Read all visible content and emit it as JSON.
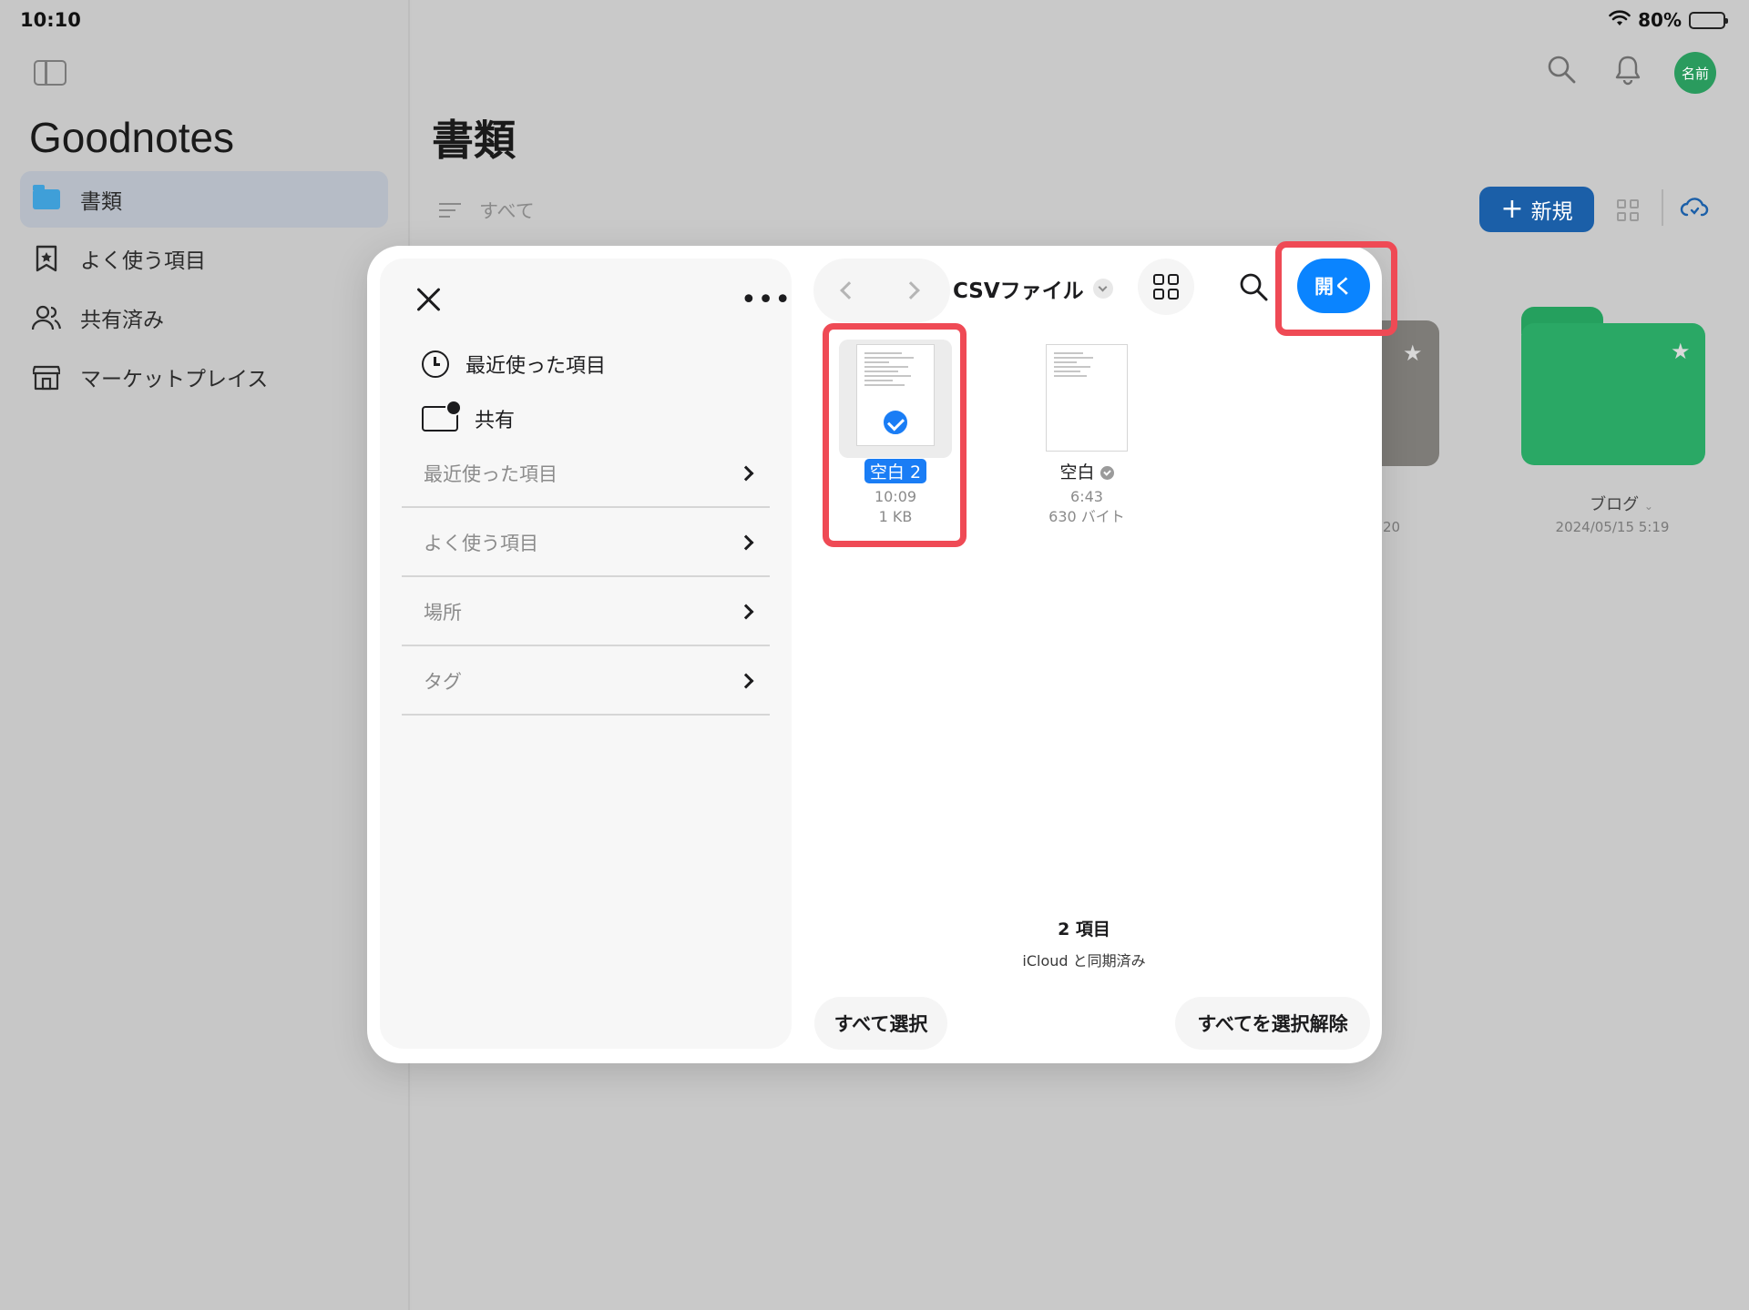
{
  "status": {
    "time": "10:10",
    "battery": "80%",
    "battery_level": 0.8
  },
  "app": {
    "title": "Goodnotes",
    "nav": [
      {
        "label": "書類",
        "icon": "folder-icon",
        "active": true
      },
      {
        "label": "よく使う項目",
        "icon": "bookmark-star-icon"
      },
      {
        "label": "共有済み",
        "icon": "people-icon"
      },
      {
        "label": "マーケットプレイス",
        "icon": "storefront-icon"
      }
    ],
    "avatar_label": "名前"
  },
  "main": {
    "page_title": "書類",
    "filter_label": "すべて",
    "new_button": "新規",
    "folders": [
      {
        "name": "ブログ",
        "date": "2024/05/15 5:19"
      },
      {
        "date_partial": "20"
      }
    ]
  },
  "picker": {
    "more_label": "•••",
    "quick": [
      {
        "label": "最近使った項目",
        "icon": "clock-icon"
      },
      {
        "label": "共有",
        "icon": "shared-folder-icon"
      }
    ],
    "sections": [
      "最近使った項目",
      "よく使う項目",
      "場所",
      "タグ"
    ],
    "folder_title": "CSVファイル",
    "open_button": "開く",
    "files": [
      {
        "name": "空白 2",
        "time": "10:09",
        "size": "1 KB",
        "selected": true
      },
      {
        "name": "空白",
        "time": "6:43",
        "size": "630 バイト",
        "selected": false
      }
    ],
    "count": "2 項目",
    "sync": "iCloud と同期済み",
    "select_all": "すべて選択",
    "deselect_all": "すべてを選択解除"
  },
  "colors": {
    "accent": "#0a84ff",
    "highlight": "#ef4a55",
    "folder_green": "#2aa865",
    "new_button": "#1b5fa8",
    "avatar": "#2a9b5e"
  }
}
